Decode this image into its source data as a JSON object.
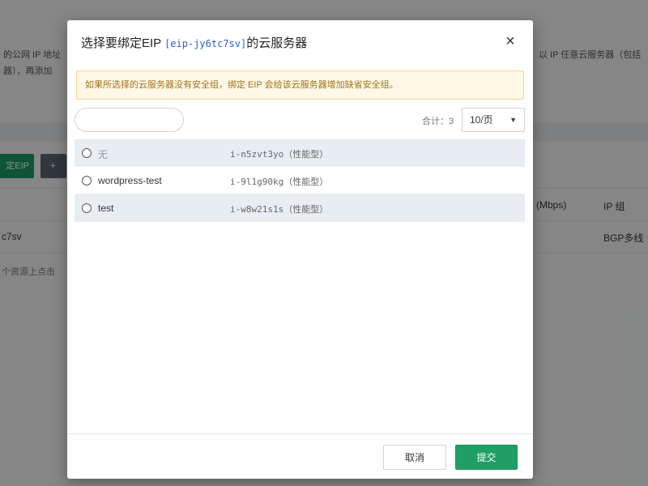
{
  "background": {
    "desc_left_line1": "的公网 IP 地址",
    "desc_left_line2": "器），再添加",
    "desc_right": "以 IP 任意云服务器（包括",
    "green_button": "定EIP",
    "grey_button": "+",
    "col_bandwidth": "(Mbps)",
    "col_ip": "IP 组",
    "row_id": "c7sv",
    "row_line": "BGP多线",
    "hint": "个资源上点击"
  },
  "modal": {
    "title_prefix": "选择要绑定EIP ",
    "title_eip": "[eip-jy6tc7sv]",
    "title_suffix": "的云服务器",
    "close_icon": "×"
  },
  "warning": "如果所选择的云服务器没有安全组，绑定 EIP 会给该云服务器增加缺省安全组。",
  "search": {
    "placeholder": "",
    "value": ""
  },
  "total": "合计：3",
  "page_size": {
    "selected": "10/页",
    "caret": "▼"
  },
  "rows": [
    {
      "name": "无",
      "instance": "i-n5zvt3yo（性能型）",
      "selected": false
    },
    {
      "name": "wordpress-test",
      "instance": "i-9l1g90kg（性能型）",
      "selected": false
    },
    {
      "name": "test",
      "instance": "i-w8w21s1s（性能型）",
      "selected": false
    }
  ],
  "footer": {
    "cancel_label": "取消",
    "submit_label": "提交"
  },
  "colors": {
    "primary": "#1f9e66",
    "link": "#2b62c9",
    "warning_bg": "#fff8e6",
    "warning_text": "#a0711a"
  }
}
